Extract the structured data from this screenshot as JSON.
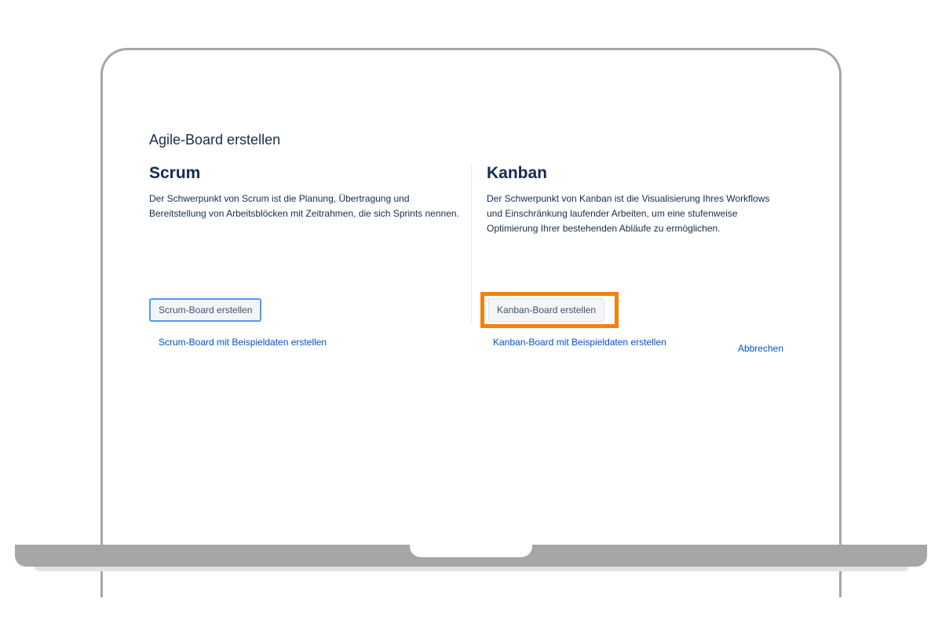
{
  "dialog": {
    "title": "Agile-Board erstellen",
    "cancel_label": "Abbrechen"
  },
  "scrum": {
    "heading": "Scrum",
    "description": "Der Schwerpunkt von Scrum ist die Planung, Übertragung und Bereitstellung von Arbeitsblöcken mit Zeitrahmen, die sich Sprints nennen.",
    "create_button_label": "Scrum-Board erstellen",
    "sample_link_label": "Scrum-Board mit Beispieldaten erstellen"
  },
  "kanban": {
    "heading": "Kanban",
    "description": "Der Schwerpunkt von Kanban ist die Visualisierung Ihres Workflows und Einschränkung laufender Arbeiten, um eine stufenweise Optimierung Ihrer bestehenden Abläufe zu ermöglichen.",
    "create_button_label": "Kanban-Board erstellen",
    "sample_link_label": "Kanban-Board mit Beispieldaten erstellen"
  },
  "colors": {
    "highlight": "#f0820f",
    "link": "#0052cc",
    "focus_ring": "#4c9aff",
    "device_frame": "#a6a6a6"
  }
}
